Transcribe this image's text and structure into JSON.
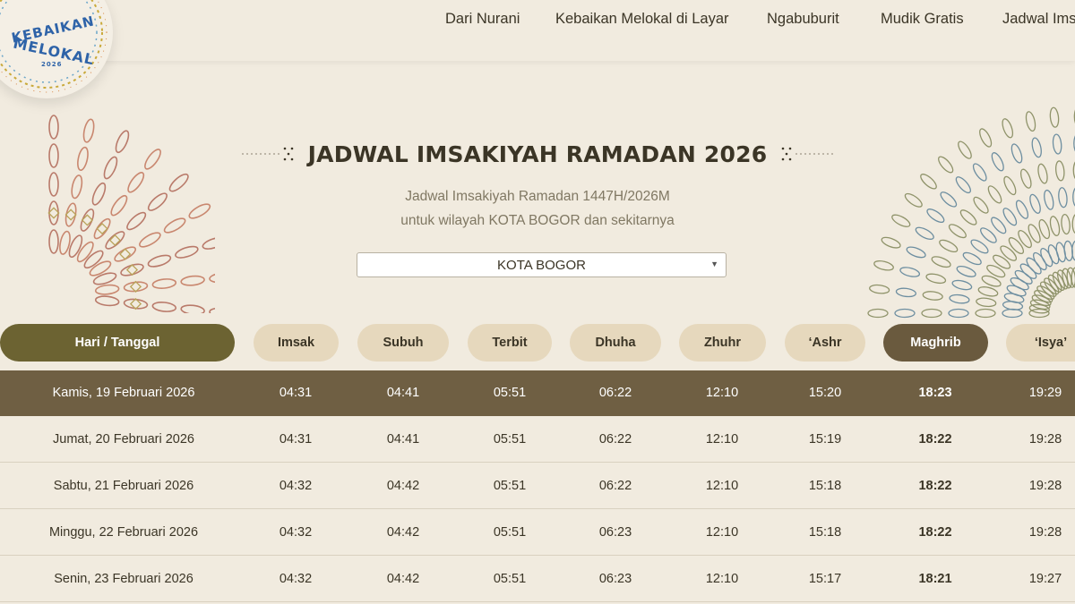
{
  "logo": {
    "line1": "KEBAIKAN",
    "line2": "MELOKAL",
    "year": "2026"
  },
  "nav": [
    {
      "label": "Dari Nurani"
    },
    {
      "label": "Kebaikan Melokal di Layar"
    },
    {
      "label": "Ngabuburit"
    },
    {
      "label": "Mudik Gratis"
    },
    {
      "label": "Jadwal Imsakiyah"
    }
  ],
  "heading": {
    "title": "JADWAL IMSAKIYAH RAMADAN 2026",
    "subtitle_line1": "Jadwal Imsakiyah Ramadan 1447H/2026M",
    "subtitle_line2": "untuk wilayah KOTA BOGOR dan sekitarnya"
  },
  "city_select": {
    "value": "KOTA BOGOR"
  },
  "table": {
    "headers": [
      "Hari / Tanggal",
      "Imsak",
      "Subuh",
      "Terbit",
      "Dhuha",
      "Zhuhr",
      "‘Ashr",
      "Maghrib",
      "‘Isya’"
    ],
    "rows": [
      [
        "Kamis, 19 Februari 2026",
        "04:31",
        "04:41",
        "05:51",
        "06:22",
        "12:10",
        "15:20",
        "18:23",
        "19:29"
      ],
      [
        "Jumat, 20 Februari 2026",
        "04:31",
        "04:41",
        "05:51",
        "06:22",
        "12:10",
        "15:19",
        "18:22",
        "19:28"
      ],
      [
        "Sabtu, 21 Februari 2026",
        "04:32",
        "04:42",
        "05:51",
        "06:22",
        "12:10",
        "15:18",
        "18:22",
        "19:28"
      ],
      [
        "Minggu, 22 Februari 2026",
        "04:32",
        "04:42",
        "05:51",
        "06:23",
        "12:10",
        "15:18",
        "18:22",
        "19:28"
      ],
      [
        "Senin, 23 Februari 2026",
        "04:32",
        "04:42",
        "05:51",
        "06:23",
        "12:10",
        "15:17",
        "18:21",
        "19:27"
      ]
    ],
    "active_row": 0,
    "highlight_column": 7
  },
  "colors": {
    "background": "#f1ebdf",
    "pill": "#e6d8bd",
    "pill_primary": "#6c6332",
    "pill_maghrib": "#6a5a3e",
    "active_row": "#6f5f43",
    "text": "#3b3526",
    "logo_blue": "#2e63a8"
  },
  "icons": [
    "select-arrow-icon",
    "title-ornament-icon"
  ]
}
